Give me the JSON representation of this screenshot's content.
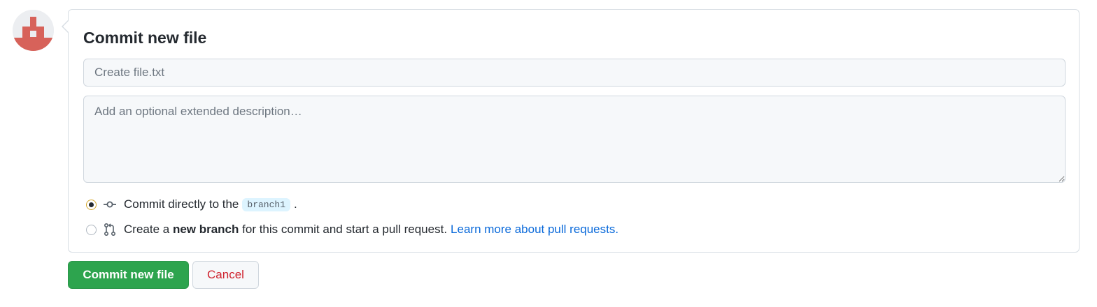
{
  "avatar": {
    "icon": "identicon-avatar",
    "color": "#d7625a"
  },
  "form": {
    "title": "Commit new file",
    "summary_placeholder": "Create file.txt",
    "summary_value": "",
    "description_placeholder": "Add an optional extended description…",
    "description_value": ""
  },
  "options": {
    "direct": {
      "selected": true,
      "icon": "git-commit-icon",
      "text_before": "Commit directly to the",
      "branch": "branch1",
      "text_after": "."
    },
    "new_branch": {
      "selected": false,
      "icon": "git-pull-request-icon",
      "text_before": "Create a",
      "bold": "new branch",
      "text_after": "for this commit and start a pull request.",
      "link": "Learn more about pull requests."
    }
  },
  "buttons": {
    "commit": "Commit new file",
    "cancel": "Cancel"
  },
  "colors": {
    "primary_button": "#2da44e",
    "cancel_text": "#cf222e",
    "link": "#0969da"
  }
}
